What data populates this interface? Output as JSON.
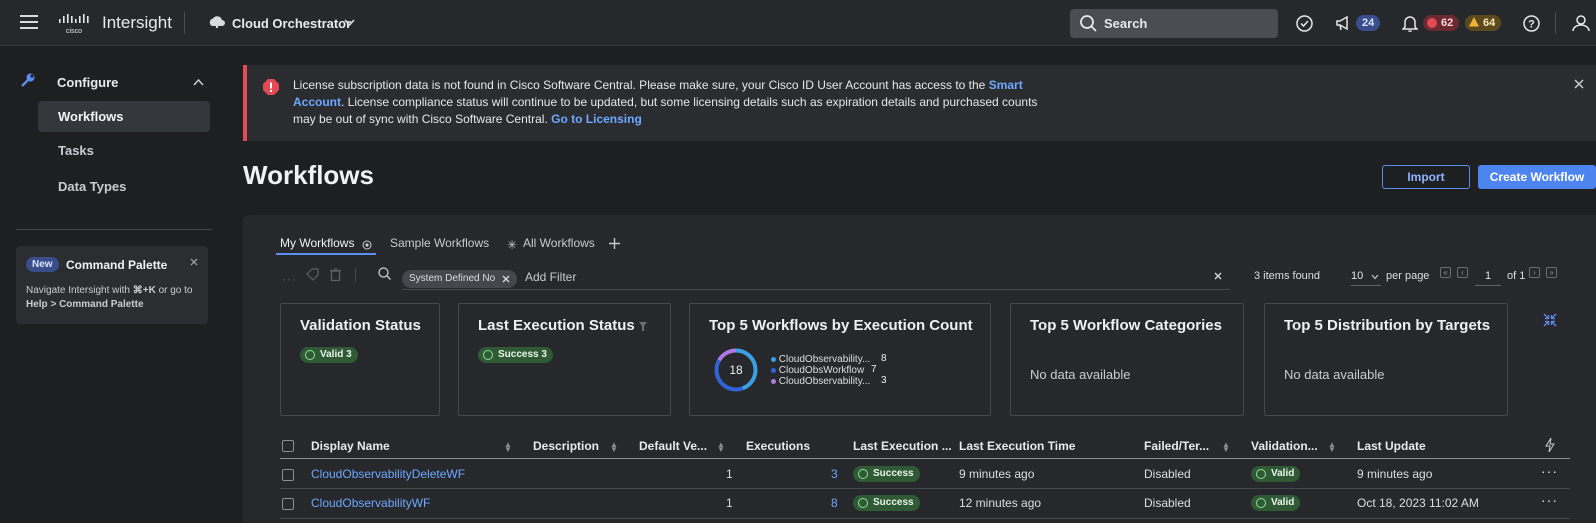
{
  "header": {
    "brand": "Intersight",
    "scope": "Cloud Orchestrator",
    "search_label": "Search",
    "announcements_count": "24",
    "alarms_critical": "62",
    "alarms_warning": "64"
  },
  "sidebar": {
    "section": "Configure",
    "items": [
      {
        "label": "Workflows",
        "active": true
      },
      {
        "label": "Tasks",
        "active": false
      },
      {
        "label": "Data Types",
        "active": false
      }
    ],
    "command_palette": {
      "badge": "New",
      "title": "Command Palette",
      "text_1": "Navigate Intersight with",
      "shortcut": "⌘+K",
      "text_2": "or go",
      "text_3": "to",
      "path": "Help > Command Palette"
    }
  },
  "banner": {
    "text_1": "License subscription data is not found in Cisco Software Central. Please make sure, your Cisco ID User Account has access to the",
    "link_1": "Smart Account",
    "text_2": ". License compliance status will continue to be updated, but some licensing details such as expiration details and purchased counts may be out of sync with Cisco Software Central.",
    "link_2": "Go to Licensing"
  },
  "page": {
    "title": "Workflows",
    "import_label": "Import",
    "create_label": "Create Workflow"
  },
  "tabs": [
    "My Workflows",
    "Sample Workflows",
    "All Workflows"
  ],
  "filter": {
    "chip": "System Defined No",
    "placeholder": "Add Filter",
    "items_found": "3 items found",
    "per_page_value": "10",
    "per_page_label": "per page",
    "page_value": "1",
    "page_of": "of 1"
  },
  "widgets": {
    "validation": {
      "title": "Validation Status",
      "badge": "Valid 3"
    },
    "last_exec": {
      "title": "Last Execution Status",
      "badge": "Success 3"
    },
    "top_workflows": {
      "title": "Top 5 Workflows by Execution Count",
      "total": "18",
      "items": [
        {
          "label": "CloudObservability...",
          "count": "8",
          "color": "#3aa0e6"
        },
        {
          "label": "CloudObsWorkflow",
          "count": "7",
          "color": "#2f63d6"
        },
        {
          "label": "CloudObservability...",
          "count": "3",
          "color": "#b07ae6"
        }
      ]
    },
    "categories": {
      "title": "Top 5 Workflow Categories",
      "empty": "No data available"
    },
    "targets": {
      "title": "Top 5 Distribution by Targets",
      "empty": "No data available"
    }
  },
  "table": {
    "columns": [
      "Display Name",
      "Description",
      "Default Ve...",
      "Executions",
      "Last Execution ...",
      "Last Execution Time",
      "Failed/Ter...",
      "Validation...",
      "Last Update"
    ],
    "rows": [
      {
        "name": "CloudObservabilityDeleteWF",
        "description": "",
        "version": "1",
        "executions": "3",
        "last_status": "Success",
        "last_time": "9 minutes ago",
        "failed": "Disabled",
        "validation": "Valid",
        "last_update": "9 minutes ago"
      },
      {
        "name": "CloudObservabilityWF",
        "description": "",
        "version": "1",
        "executions": "8",
        "last_status": "Success",
        "last_time": "12 minutes ago",
        "failed": "Disabled",
        "validation": "Valid",
        "last_update": "Oct 18, 2023 11:02 AM"
      }
    ]
  }
}
